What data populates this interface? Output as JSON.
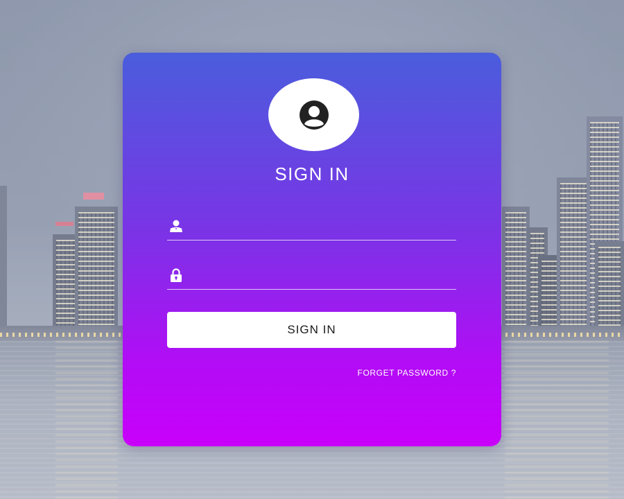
{
  "login": {
    "title": "SIGN IN",
    "username": {
      "value": "",
      "placeholder": "",
      "icon": "user-icon"
    },
    "password": {
      "value": "",
      "placeholder": "",
      "icon": "lock-icon"
    },
    "submit_label": "SIGN IN",
    "forgot_label": "FORGET PASSWORD ?",
    "avatar_icon": "user-circle-icon"
  },
  "colors": {
    "card_gradient_top": "#4a5ddc",
    "card_gradient_bottom": "#c900fb",
    "button_bg": "#ffffff",
    "text": "#ffffff"
  }
}
